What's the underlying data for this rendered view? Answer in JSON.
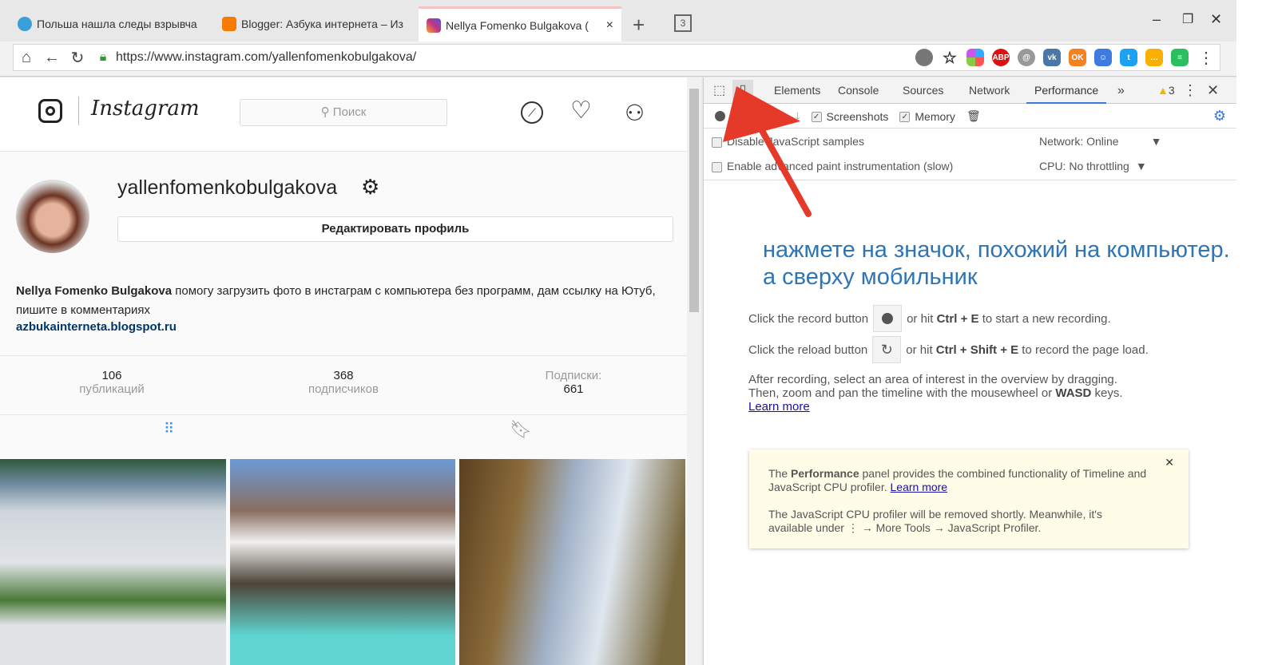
{
  "browser": {
    "tabs": [
      {
        "title": "Польша нашла следы взрывча",
        "favicon_color": "#3aa0d8"
      },
      {
        "title": "Blogger: Азбука интернета – Из",
        "favicon_color": "#f57c00"
      },
      {
        "title": "Nellya Fomenko Bulgakova (",
        "favicon_color": "#c13584",
        "active": true
      }
    ],
    "new_tab": "+",
    "tab_count": "3",
    "close_tab": "×",
    "url": "https://www.instagram.com/yallenfomenkobulgakova/",
    "extensions": [
      "cookie-icon",
      "star-icon",
      "colors-icon",
      "ABP",
      "mail-icon",
      "vk-icon",
      "ok-icon",
      "smile-icon",
      "twitter-icon",
      "chat-icon",
      "evernote-icon"
    ],
    "abp": "ABP",
    "vk": "vk"
  },
  "instagram": {
    "logo": "Instagram",
    "search_placeholder": "Поиск",
    "username": "yallenfomenkobulgakova",
    "edit_profile": "Редактировать профиль",
    "bio_name": "Nellya Fomenko Bulgakova",
    "bio_text": " помогу загрузить фото в инстаграм с компьютера без программ, дам ссылку на Ютуб, пишите в комментариях",
    "link": "azbukainterneta.blogspot.ru",
    "stats": [
      {
        "value": "106",
        "label": "публикаций"
      },
      {
        "value": "368",
        "label": "подписчиков"
      },
      {
        "label": "Подписки:",
        "value": "661"
      }
    ]
  },
  "devtools": {
    "tabs": [
      "Elements",
      "Console",
      "Sources",
      "Network",
      "Performance"
    ],
    "active_tab": "Performance",
    "more": "»",
    "warnings": "3",
    "screenshots": "Screenshots",
    "memory": "Memory",
    "disable_js": "Disable JavaScript samples",
    "advanced_paint": "Enable advanced paint instrumentation (slow)",
    "network_label": "Network:",
    "network_value": "Online",
    "cpu_label": "CPU:",
    "cpu_value": "No throttling",
    "record_pre": "Click the record button",
    "record_post1": "or hit ",
    "record_keys": "Ctrl + E",
    "record_post2": " to start a new recording.",
    "reload_pre": "Click the reload button",
    "reload_post1": "or hit ",
    "reload_keys": "Ctrl + Shift + E",
    "reload_post2": " to record the page load.",
    "after1": "After recording, select an area of interest in the overview by dragging.",
    "after2a": "Then, zoom and pan the timeline with the mousewheel or ",
    "after2b": "WASD",
    "after2c": " keys.",
    "learn_more": "Learn more",
    "info1a": "The ",
    "info1b": "Performance",
    "info1c": " panel provides the combined functionality of Timeline and JavaScript CPU profiler. ",
    "info2": "The JavaScript CPU profiler will be removed shortly. Meanwhile, it's available under ⋮ → More Tools → JavaScript Profiler."
  },
  "annotation": {
    "line1": "нажмете на значок, похожий на компьютер.",
    "line2": "а сверху мобильник",
    "color": "#2e75b6",
    "arrow_color": "#e53a2a"
  }
}
